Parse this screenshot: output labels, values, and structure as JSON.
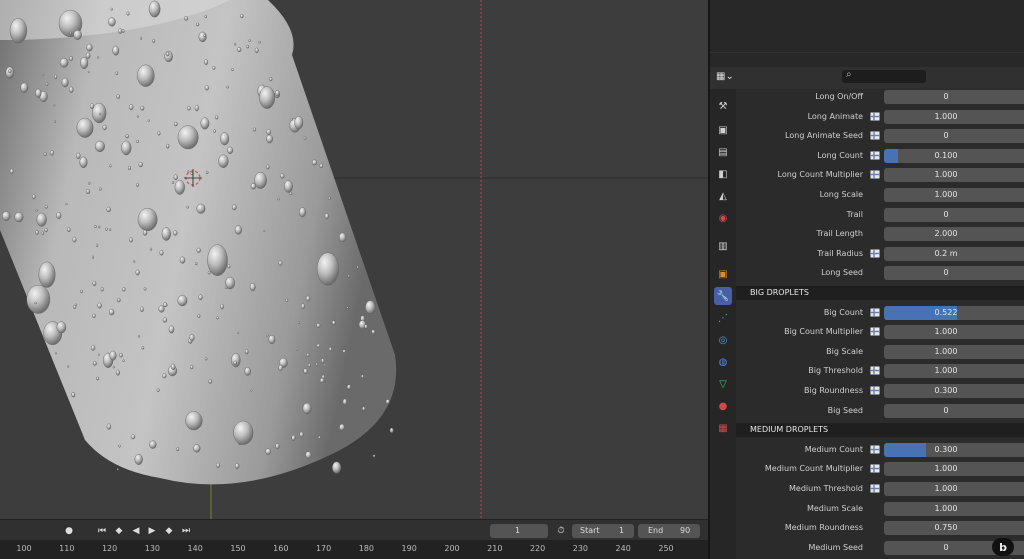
{
  "viewport": {
    "label": "3D viewport - water droplets on cylinder"
  },
  "props_header": {
    "editor_type_icon": "properties-editor-icon",
    "search_placeholder": ""
  },
  "tabs": [
    {
      "name": "tool-tab",
      "glyph": "⚒",
      "color": "#d0d0d0"
    },
    {
      "name": "render-tab",
      "glyph": "▣",
      "color": "#d0d0d0"
    },
    {
      "name": "output-tab",
      "glyph": "▤",
      "color": "#d0d0d0"
    },
    {
      "name": "view-layer-tab",
      "glyph": "◧",
      "color": "#d0d0d0"
    },
    {
      "name": "scene-tab",
      "glyph": "◭",
      "color": "#d0d0d0"
    },
    {
      "name": "world-tab",
      "glyph": "◉",
      "color": "#d04a4a"
    },
    {
      "name": "collection-tab",
      "glyph": "▥",
      "color": "#d0d0d0"
    },
    {
      "name": "object-tab",
      "glyph": "▣",
      "color": "#e08a2a"
    },
    {
      "name": "modifier-tab",
      "glyph": "🔧",
      "color": "#5a8ae0",
      "active": true
    },
    {
      "name": "particles-tab",
      "glyph": "⋰",
      "color": "#5aa0e0"
    },
    {
      "name": "physics-tab",
      "glyph": "◎",
      "color": "#5aa0e0"
    },
    {
      "name": "constraints-tab",
      "glyph": "◍",
      "color": "#5a8ae0"
    },
    {
      "name": "data-tab",
      "glyph": "▽",
      "color": "#3cc07a"
    },
    {
      "name": "material-tab",
      "glyph": "●",
      "color": "#d04a4a"
    },
    {
      "name": "texture-tab",
      "glyph": "▦",
      "color": "#d04a4a"
    }
  ],
  "rows": [
    {
      "label": "Long On/Off",
      "value": "0",
      "kf": false,
      "fill": 0
    },
    {
      "label": "Long Animate",
      "value": "1.000",
      "kf": true,
      "fill": 0
    },
    {
      "label": "Long Animate Seed",
      "value": "0",
      "kf": true,
      "fill": 0
    },
    {
      "label": "Long Count",
      "value": "0.100",
      "kf": true,
      "fill": 0.1
    },
    {
      "label": "Long Count Multiplier",
      "value": "1.000",
      "kf": true,
      "fill": 0
    },
    {
      "label": "Long Scale",
      "value": "1.000",
      "kf": false,
      "fill": 0
    },
    {
      "label": "Trail",
      "value": "0",
      "kf": false,
      "fill": 0
    },
    {
      "label": "Trail Length",
      "value": "2.000",
      "kf": false,
      "fill": 0
    },
    {
      "label": "Trail Radius",
      "value": "0.2 m",
      "kf": true,
      "fill": 0
    },
    {
      "label": "Long Seed",
      "value": "0",
      "kf": false,
      "fill": 0
    },
    {
      "section": "BIG DROPLETS"
    },
    {
      "label": "Big Count",
      "value": "0.522",
      "kf": true,
      "fill": 0.522
    },
    {
      "label": "Big Count Multiplier",
      "value": "1.000",
      "kf": true,
      "fill": 0
    },
    {
      "label": "Big Scale",
      "value": "1.000",
      "kf": false,
      "fill": 0
    },
    {
      "label": "Big Threshold",
      "value": "1.000",
      "kf": true,
      "fill": 0
    },
    {
      "label": "Big Roundness",
      "value": "0.300",
      "kf": true,
      "fill": 0
    },
    {
      "label": "Big Seed",
      "value": "0",
      "kf": false,
      "fill": 0
    },
    {
      "section": "MEDIUM DROPLETS"
    },
    {
      "label": "Medium Count",
      "value": "0.300",
      "kf": true,
      "fill": 0.3
    },
    {
      "label": "Medium Count Multiplier",
      "value": "1.000",
      "kf": true,
      "fill": 0
    },
    {
      "label": "Medium Threshold",
      "value": "1.000",
      "kf": true,
      "fill": 0
    },
    {
      "label": "Medium Scale",
      "value": "1.000",
      "kf": false,
      "fill": 0
    },
    {
      "label": "Medium Roundness",
      "value": "0.750",
      "kf": false,
      "fill": 0
    },
    {
      "label": "Medium Seed",
      "value": "0",
      "kf": false,
      "fill": 0
    }
  ],
  "timeline": {
    "current_frame": "1",
    "start_label": "Start",
    "start_value": "1",
    "end_label": "End",
    "end_value": "90"
  },
  "ruler": [
    "100",
    "110",
    "120",
    "130",
    "140",
    "150",
    "160",
    "170",
    "180",
    "190",
    "200",
    "210",
    "220",
    "230",
    "240",
    "250"
  ],
  "colors": {
    "accent": "#4772b3",
    "active_tab": "#4a5ea8"
  }
}
